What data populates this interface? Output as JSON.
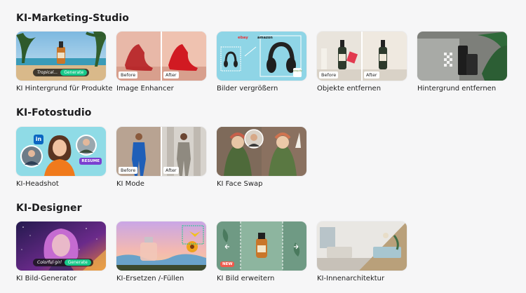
{
  "sections": [
    {
      "title": "KI-Marketing-Studio",
      "cards": [
        {
          "label": "KI Hintergrund für Produkte",
          "overlay_text": "Tropical...",
          "overlay_button": "Generate"
        },
        {
          "label": "Image Enhancer",
          "before": "Before",
          "after": "After"
        },
        {
          "label": "Bilder vergrößern",
          "logos": [
            "ebay",
            "amazon",
            "shopify"
          ]
        },
        {
          "label": "Objekte entfernen",
          "before": "Before",
          "after": "After"
        },
        {
          "label": "Hintergrund entfernen"
        }
      ]
    },
    {
      "title": "KI-Fotostudio",
      "cards": [
        {
          "label": "KI-Headshot",
          "badge": "RESUME",
          "linkedin": "in"
        },
        {
          "label": "KI Mode",
          "before": "Before",
          "after": "After"
        },
        {
          "label": "KI Face Swap"
        }
      ]
    },
    {
      "title": "KI-Designer",
      "cards": [
        {
          "label": "KI Bild-Generator",
          "overlay_text": "Colorful girl",
          "overlay_button": "Generate"
        },
        {
          "label": "KI-Ersetzen /-Füllen"
        },
        {
          "label": "KI Bild erweitern",
          "badge": "NEW"
        },
        {
          "label": "KI-Innenarchitektur"
        }
      ]
    }
  ],
  "colors": {
    "background": "#f6f6f7",
    "generate_button": "#19c98a",
    "resume_badge": "#7b3fd0",
    "new_badge": "#ef5a4c",
    "linkedin": "#0a66c2"
  }
}
